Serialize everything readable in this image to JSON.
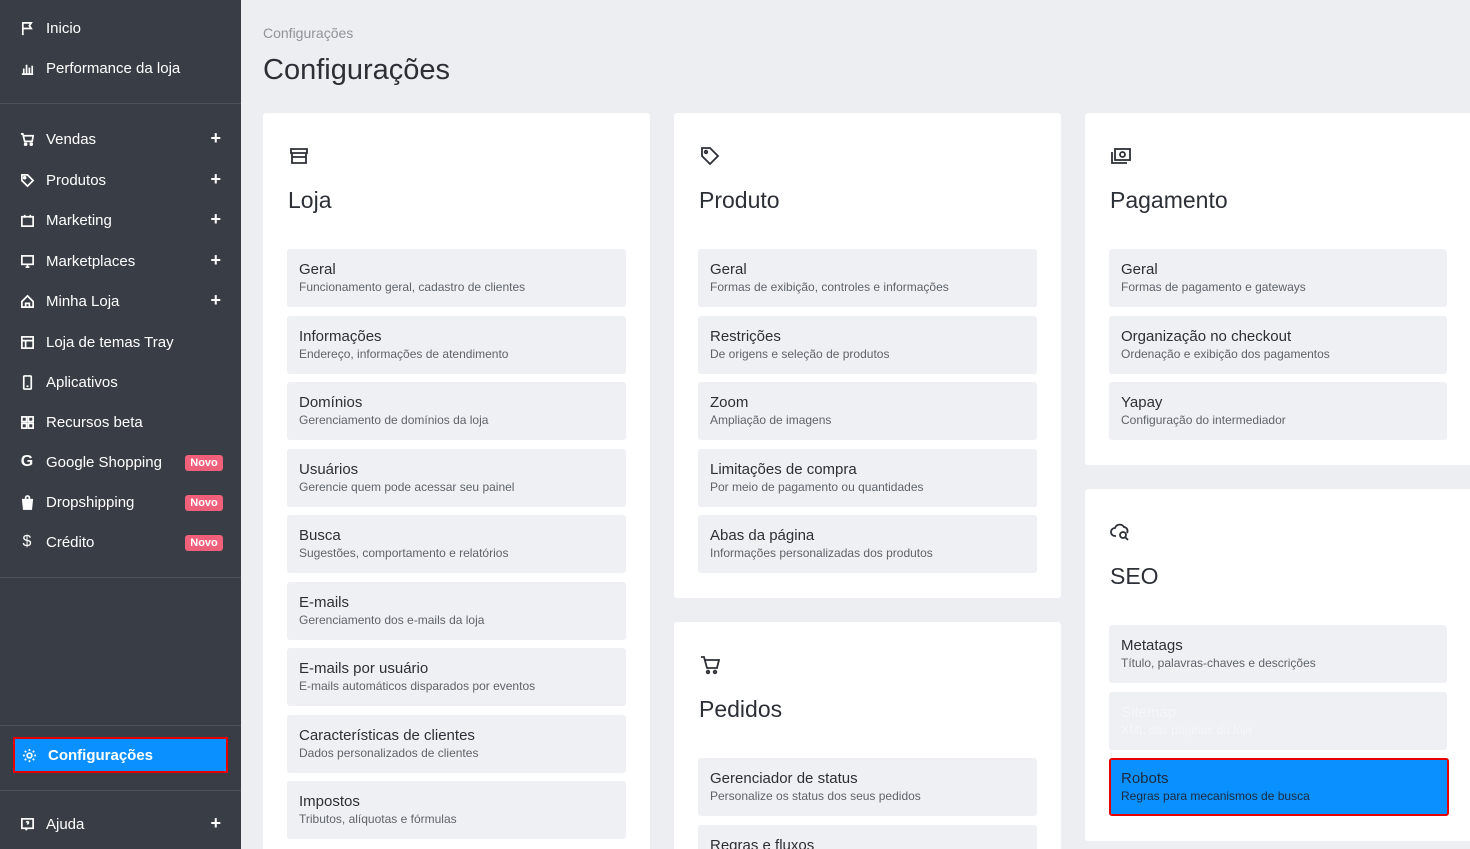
{
  "sidebar": {
    "top_items": [
      {
        "label": "Inicio",
        "icon": "flag-icon"
      },
      {
        "label": "Performance da loja",
        "icon": "bar-chart-icon"
      }
    ],
    "menu_items": [
      {
        "label": "Vendas",
        "icon": "cart-icon",
        "expand": "+"
      },
      {
        "label": "Produtos",
        "icon": "tag-icon",
        "expand": "+"
      },
      {
        "label": "Marketing",
        "icon": "calendar-icon",
        "expand": "+"
      },
      {
        "label": "Marketplaces",
        "icon": "monitor-icon",
        "expand": "+"
      },
      {
        "label": "Minha Loja",
        "icon": "home-icon",
        "expand": "+"
      },
      {
        "label": "Loja de temas Tray",
        "icon": "layout-icon"
      },
      {
        "label": "Aplicativos",
        "icon": "phone-icon"
      },
      {
        "label": "Recursos beta",
        "icon": "grid-icon"
      },
      {
        "label": "Google Shopping",
        "icon": "google-icon",
        "badge": "Novo"
      },
      {
        "label": "Dropshipping",
        "icon": "bag-icon",
        "badge": "Novo"
      },
      {
        "label": "Crédito",
        "icon": "dollar-icon",
        "badge": "Novo"
      }
    ],
    "settings": {
      "label": "Configurações",
      "icon": "gear-icon"
    },
    "help": {
      "label": "Ajuda",
      "icon": "help-icon",
      "expand": "+"
    }
  },
  "breadcrumb": "Configurações",
  "page_title": "Configurações",
  "cards": {
    "loja": {
      "title": "Loja",
      "icon": "store-icon",
      "items": [
        {
          "title": "Geral",
          "desc": "Funcionamento geral, cadastro de clientes"
        },
        {
          "title": "Informações",
          "desc": "Endereço, informações de atendimento"
        },
        {
          "title": "Domínios",
          "desc": "Gerenciamento de domínios da loja"
        },
        {
          "title": "Usuários",
          "desc": "Gerencie quem pode acessar seu painel"
        },
        {
          "title": "Busca",
          "desc": "Sugestões, comportamento e relatórios"
        },
        {
          "title": "E-mails",
          "desc": "Gerenciamento dos e-mails da loja"
        },
        {
          "title": "E-mails por usuário",
          "desc": "E-mails automáticos disparados por eventos"
        },
        {
          "title": "Características de clientes",
          "desc": "Dados personalizados de clientes"
        },
        {
          "title": "Impostos",
          "desc": "Tributos, alíquotas e fórmulas"
        }
      ]
    },
    "produto": {
      "title": "Produto",
      "icon": "tag-icon",
      "items": [
        {
          "title": "Geral",
          "desc": "Formas de exibição, controles e informações"
        },
        {
          "title": "Restrições",
          "desc": "De origens e seleção de produtos"
        },
        {
          "title": "Zoom",
          "desc": "Ampliação de imagens"
        },
        {
          "title": "Limitações de compra",
          "desc": "Por meio de pagamento ou quantidades"
        },
        {
          "title": "Abas da página",
          "desc": "Informações personalizadas dos produtos"
        }
      ]
    },
    "pedidos": {
      "title": "Pedidos",
      "icon": "cart-icon",
      "items": [
        {
          "title": "Gerenciador de status",
          "desc": "Personalize os status dos seus pedidos"
        },
        {
          "title": "Regras e fluxos",
          "desc": ""
        }
      ]
    },
    "pagamento": {
      "title": "Pagamento",
      "icon": "money-icon",
      "items": [
        {
          "title": "Geral",
          "desc": "Formas de pagamento e gateways"
        },
        {
          "title": "Organização no checkout",
          "desc": "Ordenação e exibição dos pagamentos"
        },
        {
          "title": "Yapay",
          "desc": "Configuração do intermediador"
        }
      ]
    },
    "seo": {
      "title": "SEO",
      "icon": "cloud-search-icon",
      "items": [
        {
          "title": "Metatags",
          "desc": "Título, palavras-chaves e descrições"
        },
        {
          "title": "Sitemap",
          "desc": "XML das páginas da loja"
        },
        {
          "title": "Robots",
          "desc": "Regras para mecanismos de busca"
        }
      ]
    }
  },
  "colors": {
    "sidebar_bg": "#393e46",
    "accent": "#0b91ff",
    "highlight_border": "#e60000",
    "badge": "#f0607a"
  }
}
